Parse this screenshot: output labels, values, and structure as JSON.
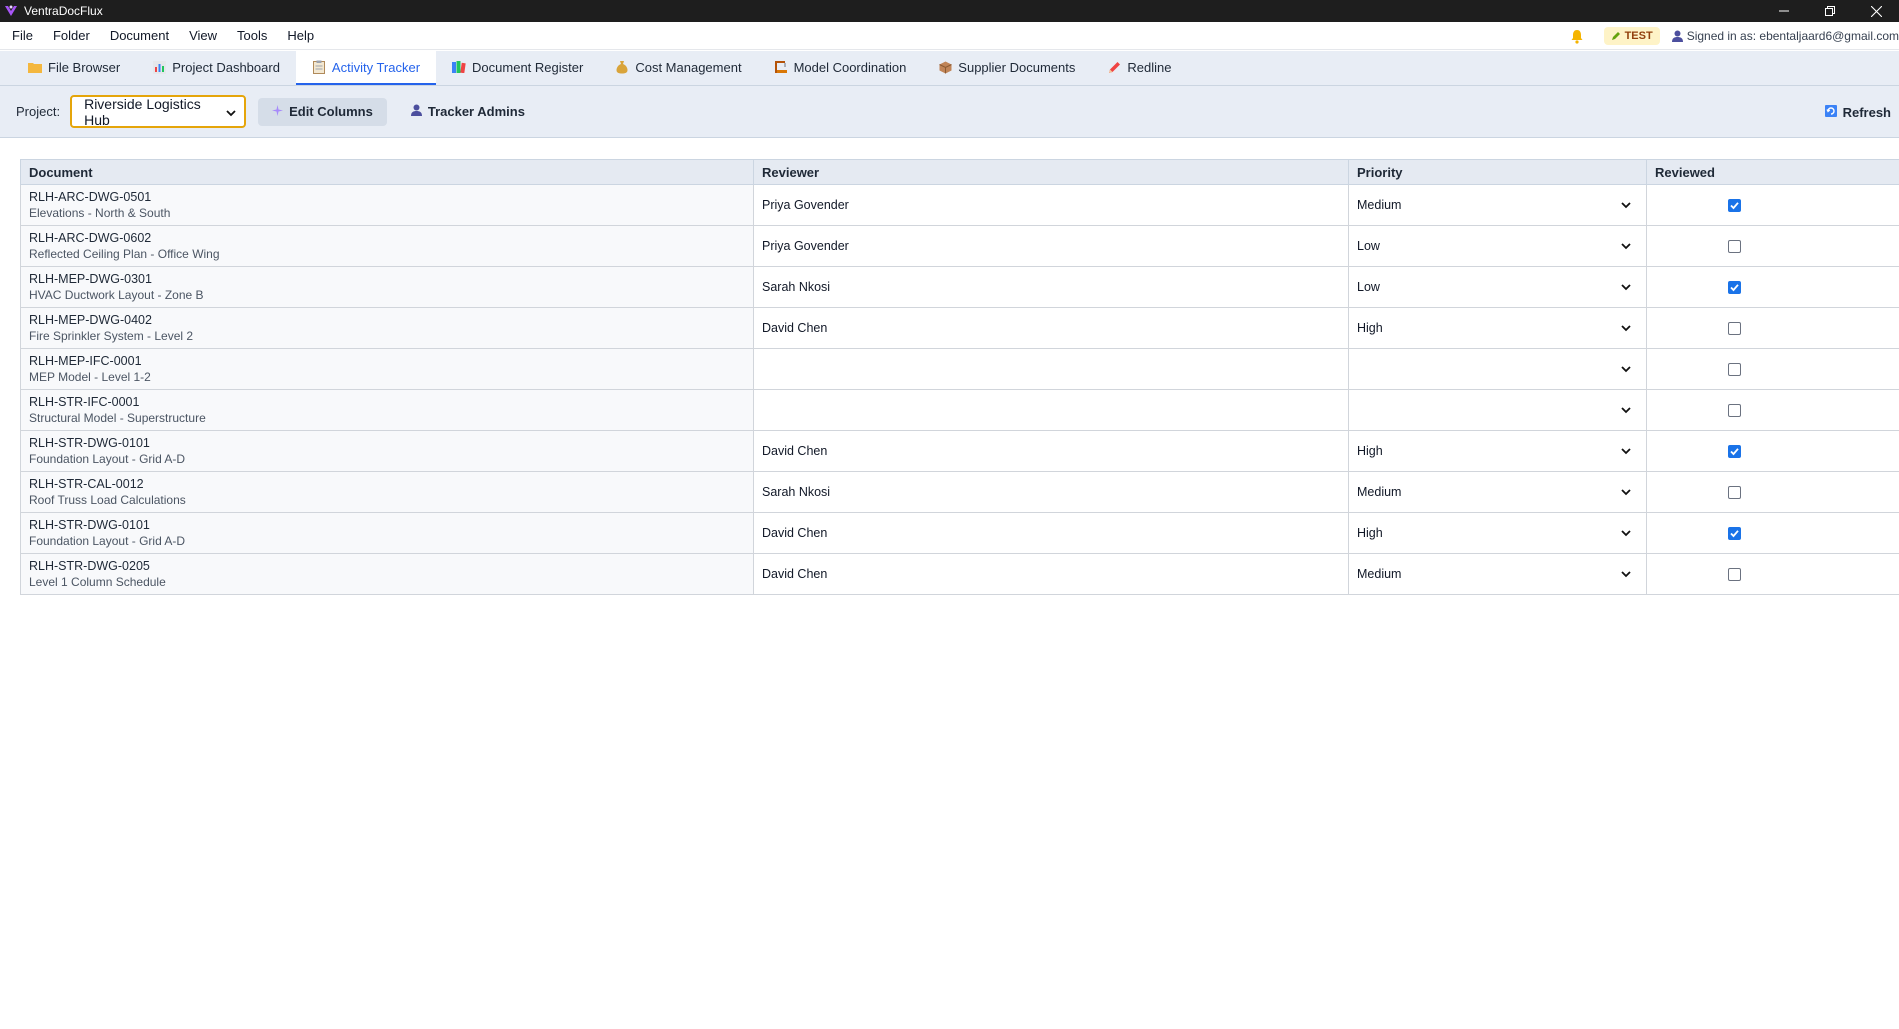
{
  "window": {
    "title": "VentraDocFlux",
    "accent": "#7c3aed"
  },
  "menu": [
    "File",
    "Folder",
    "Document",
    "View",
    "Tools",
    "Help"
  ],
  "status": {
    "badge": "TEST",
    "signed_in": "Signed in as: ebentaljaard6@gmail.com"
  },
  "tabs": [
    {
      "label": "File Browser",
      "icon": "folder-icon",
      "active": false
    },
    {
      "label": "Project Dashboard",
      "icon": "bar-chart-icon",
      "active": false
    },
    {
      "label": "Activity Tracker",
      "icon": "clipboard-icon",
      "active": true
    },
    {
      "label": "Document Register",
      "icon": "books-icon",
      "active": false
    },
    {
      "label": "Cost Management",
      "icon": "money-bag-icon",
      "active": false
    },
    {
      "label": "Model Coordination",
      "icon": "building-icon",
      "active": false
    },
    {
      "label": "Supplier Documents",
      "icon": "package-icon",
      "active": false
    },
    {
      "label": "Redline",
      "icon": "pencil-icon",
      "active": false
    }
  ],
  "toolbar": {
    "project_label": "Project:",
    "project_value": "Riverside Logistics Hub",
    "edit_columns": "Edit Columns",
    "tracker_admins": "Tracker Admins",
    "refresh": "Refresh"
  },
  "table": {
    "headers": {
      "document": "Document",
      "reviewer": "Reviewer",
      "priority": "Priority",
      "reviewed": "Reviewed"
    },
    "rows": [
      {
        "code": "RLH-ARC-DWG-0501",
        "title": "Elevations - North & South",
        "reviewer": "Priya Govender",
        "priority": "Medium",
        "reviewed": true
      },
      {
        "code": "RLH-ARC-DWG-0602",
        "title": "Reflected Ceiling Plan - Office Wing",
        "reviewer": "Priya Govender",
        "priority": "Low",
        "reviewed": false
      },
      {
        "code": "RLH-MEP-DWG-0301",
        "title": "HVAC Ductwork Layout - Zone B",
        "reviewer": "Sarah Nkosi",
        "priority": "Low",
        "reviewed": true
      },
      {
        "code": "RLH-MEP-DWG-0402",
        "title": "Fire Sprinkler System - Level 2",
        "reviewer": "David Chen",
        "priority": "High",
        "reviewed": false
      },
      {
        "code": "RLH-MEP-IFC-0001",
        "title": "MEP Model - Level 1-2",
        "reviewer": "",
        "priority": "",
        "reviewed": false
      },
      {
        "code": "RLH-STR-IFC-0001",
        "title": "Structural Model - Superstructure",
        "reviewer": "",
        "priority": "",
        "reviewed": false
      },
      {
        "code": "RLH-STR-DWG-0101",
        "title": "Foundation Layout - Grid A-D",
        "reviewer": "David Chen",
        "priority": "High",
        "reviewed": true
      },
      {
        "code": "RLH-STR-CAL-0012",
        "title": "Roof Truss Load Calculations",
        "reviewer": "Sarah Nkosi",
        "priority": "Medium",
        "reviewed": false
      },
      {
        "code": "RLH-STR-DWG-0101",
        "title": "Foundation Layout - Grid A-D",
        "reviewer": "David Chen",
        "priority": "High",
        "reviewed": true
      },
      {
        "code": "RLH-STR-DWG-0205",
        "title": "Level 1 Column Schedule",
        "reviewer": "David Chen",
        "priority": "Medium",
        "reviewed": false
      }
    ]
  }
}
